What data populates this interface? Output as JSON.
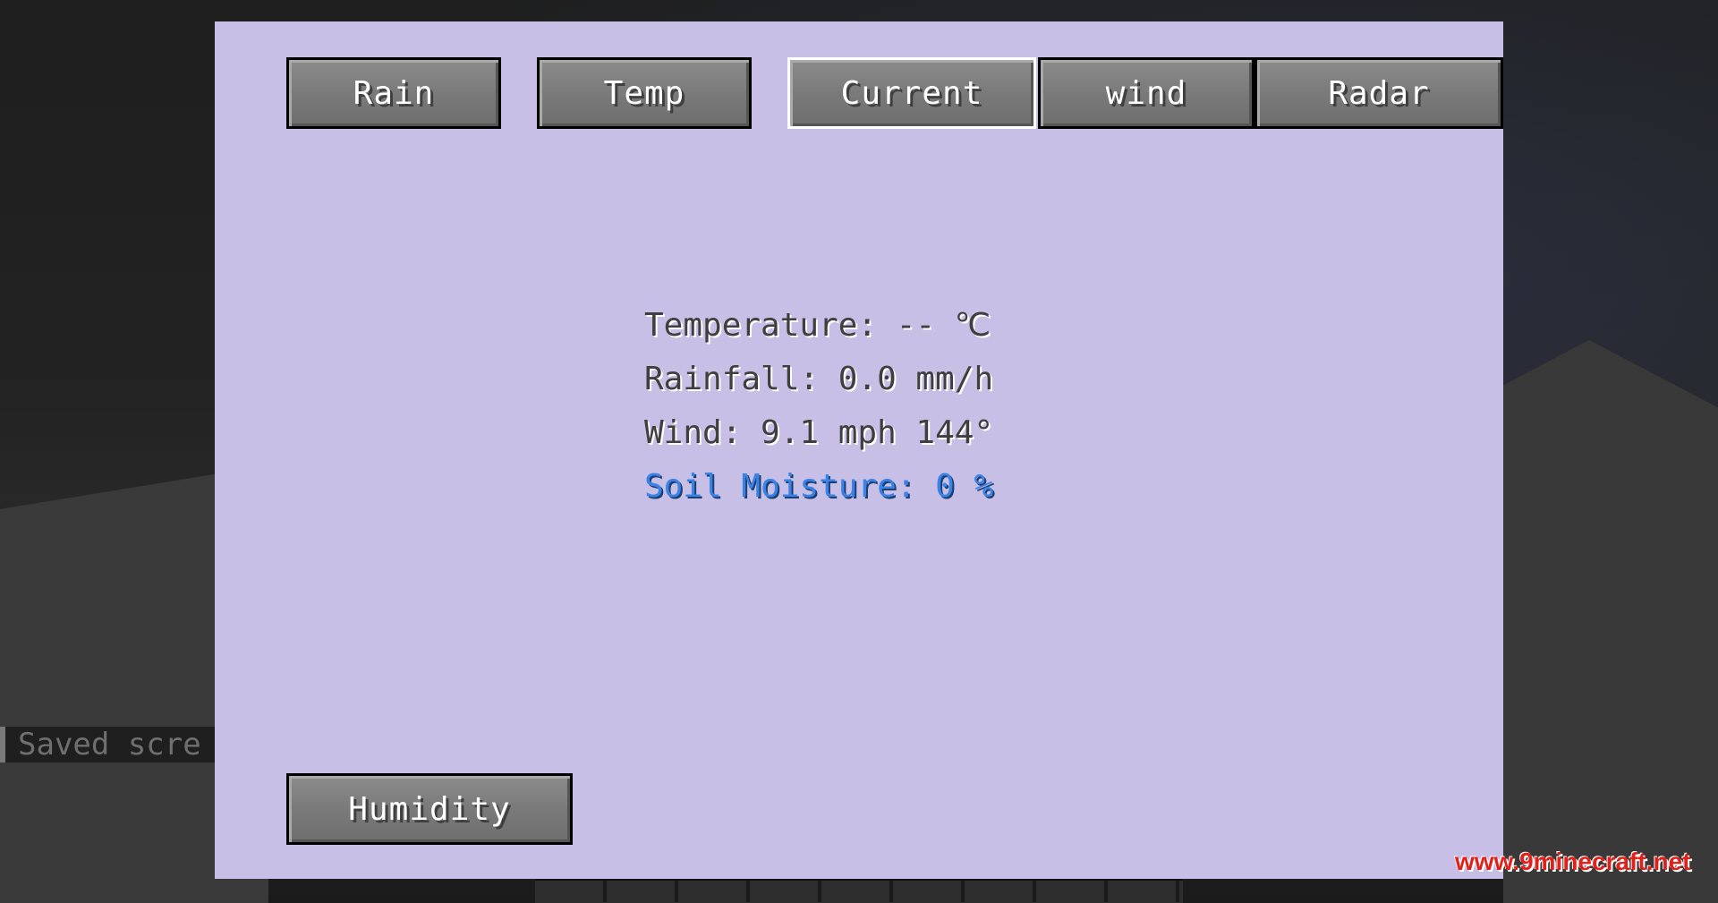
{
  "tabs": [
    {
      "label": "Rain",
      "selected": false
    },
    {
      "label": "Temp",
      "selected": false
    },
    {
      "label": "Current",
      "selected": true
    },
    {
      "label": "wind",
      "selected": false
    },
    {
      "label": "Radar",
      "selected": false
    }
  ],
  "readings": {
    "temperature": "Temperature: -- ℃",
    "rainfall": "Rainfall: 0.0 mm/h",
    "wind": "Wind: 9.1 mph 144°",
    "soil_moisture": "Soil Moisture: 0 %"
  },
  "humidity_button": "Humidity",
  "chat": {
    "partial_message": "Saved scre"
  },
  "watermark": "www.9minecraft.net",
  "colors": {
    "panel_background": "#c7bfe6",
    "soil_moisture_text": "#3b82e6",
    "watermark": "#e0211b"
  }
}
